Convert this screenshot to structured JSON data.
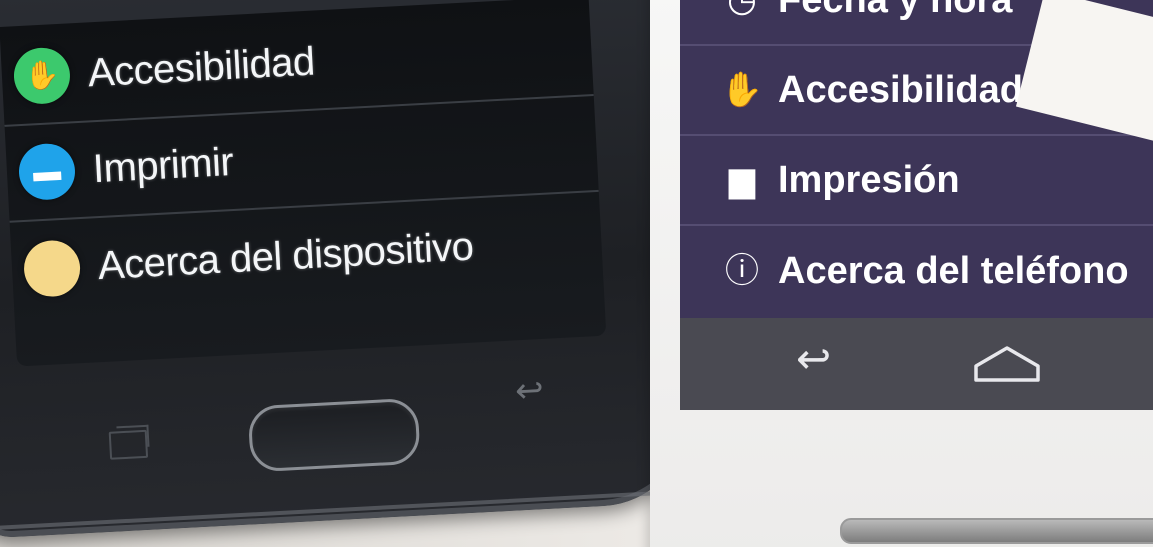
{
  "left_phone": {
    "menu": [
      {
        "label": "Accesibilidad",
        "icon": "hand-icon",
        "icon_glyph": "✋",
        "color": "#3cc96d"
      },
      {
        "label": "Imprimir",
        "icon": "printer-icon",
        "icon_glyph": "▬",
        "color": "#1fa3ea"
      },
      {
        "label": "Acerca del dispositivo",
        "icon": "info-icon",
        "icon_glyph": "",
        "color": "#f5d88a"
      }
    ],
    "keys": {
      "recent_icon": "recent-apps-icon",
      "back_glyph": "↩",
      "home_icon": "home-key"
    }
  },
  "right_phone": {
    "menu": [
      {
        "label": "Fecha y hora",
        "icon": "clock-icon",
        "icon_glyph": "◷"
      },
      {
        "label": "Accesibilidad",
        "icon": "hand-icon",
        "icon_glyph": "✋"
      },
      {
        "label": "Impresión",
        "icon": "printer-icon",
        "icon_glyph": "▆"
      },
      {
        "label": "Acerca del teléfono",
        "icon": "info-icon",
        "icon_glyph": "ⓘ"
      }
    ],
    "navbar": {
      "back_glyph": "↩",
      "home_icon": "home-icon"
    },
    "screen_color": "#3d3558"
  }
}
